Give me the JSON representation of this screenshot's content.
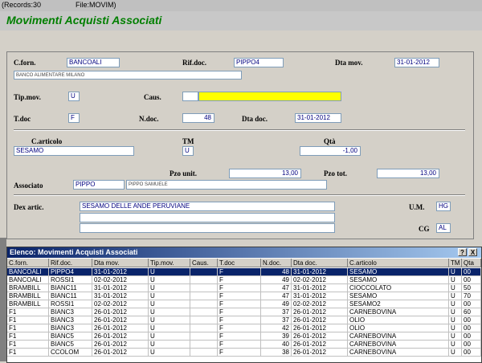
{
  "status": {
    "records": "(Records:30",
    "file": "File:MOVIM)"
  },
  "app_title": "Movimenti Acquisti Associati",
  "form": {
    "cforn_label": "C.forn.",
    "cforn_value": "BANCOALI",
    "cforn_desc": "BANCO ALIMENTARE MILANO",
    "rifdoc_label": "Rif.doc.",
    "rifdoc_value": "PIPPO4",
    "dtamov_label": "Dta mov.",
    "dtamov_value": "31-01-2012",
    "tipmov_label": "Tip.mov.",
    "tipmov_value": "U",
    "caus_label": "Caus.",
    "caus_value": "",
    "caus_desc": "",
    "tdoc_label": "T.doc",
    "tdoc_value": "F",
    "ndoc_label": "N.doc.",
    "ndoc_value": "48",
    "dtadoc_label": "Dta doc.",
    "dtadoc_value": "31-01-2012",
    "carticolo_label": "C.articolo",
    "carticolo_value": "SESAMO",
    "tm_label": "TM",
    "tm_value": "U",
    "qta_label": "Qtà",
    "qta_value": "-1,00",
    "pzounit_label": "Pzo unit.",
    "pzounit_value": "13,00",
    "pzotot_label": "Pzo tot.",
    "pzotot_value": "13,00",
    "associato_label": "Associato",
    "associato_value": "PIPPO",
    "associato_desc": "PIPPO SAMUELE",
    "dex_label": "Dex artic.",
    "dex_line1": "SESAMO DELLE ANDE PERUVIANE",
    "dex_line2": "",
    "dex_line3": "",
    "um_label": "U.M.",
    "um_value": "HG",
    "cg_label": "CG",
    "cg_value": "AL"
  },
  "grid": {
    "title": "Elenco: Movimenti Acquisti Associati",
    "help_btn": "?",
    "close_btn": "X",
    "columns": [
      "C.forn.",
      "Rif.doc.",
      "Dta mov.",
      "Tip.mov.",
      "Caus.",
      "T.doc",
      "N.doc.",
      "Dta doc.",
      "C.articolo",
      "TM",
      "Qta"
    ],
    "rows": [
      [
        "BANCOALI",
        "PIPPO4",
        "31-01-2012",
        "U",
        "",
        "F",
        "48",
        "31-01-2012",
        "SESAMO",
        "U",
        "00"
      ],
      [
        "BANCOALI",
        "ROSSI1",
        "02-02-2012",
        "U",
        "",
        "F",
        "49",
        "02-02-2012",
        "SESAMO",
        "U",
        "00"
      ],
      [
        "BRAMBILL",
        "BIANC11",
        "31-01-2012",
        "U",
        "",
        "F",
        "47",
        "31-01-2012",
        "CIOCCOLATO",
        "U",
        "50"
      ],
      [
        "BRAMBILL",
        "BIANC11",
        "31-01-2012",
        "U",
        "",
        "F",
        "47",
        "31-01-2012",
        "SESAMO",
        "U",
        "70"
      ],
      [
        "BRAMBILL",
        "ROSSI1",
        "02-02-2012",
        "U",
        "",
        "F",
        "49",
        "02-02-2012",
        "SESAMO2",
        "U",
        "00"
      ],
      [
        "F1",
        "BIANC3",
        "26-01-2012",
        "U",
        "",
        "F",
        "37",
        "26-01-2012",
        "CARNEBOVINA",
        "U",
        "60"
      ],
      [
        "F1",
        "BIANC3",
        "26-01-2012",
        "U",
        "",
        "F",
        "37",
        "26-01-2012",
        "OLIO",
        "U",
        "00"
      ],
      [
        "F1",
        "BIANC3",
        "26-01-2012",
        "U",
        "",
        "F",
        "42",
        "26-01-2012",
        "OLIO",
        "U",
        "00"
      ],
      [
        "F1",
        "BIANC5",
        "26-01-2012",
        "U",
        "",
        "F",
        "39",
        "26-01-2012",
        "CARNEBOVINA",
        "U",
        "00"
      ],
      [
        "F1",
        "BIANC5",
        "26-01-2012",
        "U",
        "",
        "F",
        "40",
        "26-01-2012",
        "CARNEBOVINA",
        "U",
        "00"
      ],
      [
        "F1",
        "CCOLOM",
        "26-01-2012",
        "U",
        "",
        "F",
        "38",
        "26-01-2012",
        "CARNEBOVINA",
        "U",
        "00"
      ]
    ]
  },
  "colors": {
    "title_green": "#007f00",
    "caus_highlight": "#ffff00",
    "selection": "#0a246a"
  }
}
